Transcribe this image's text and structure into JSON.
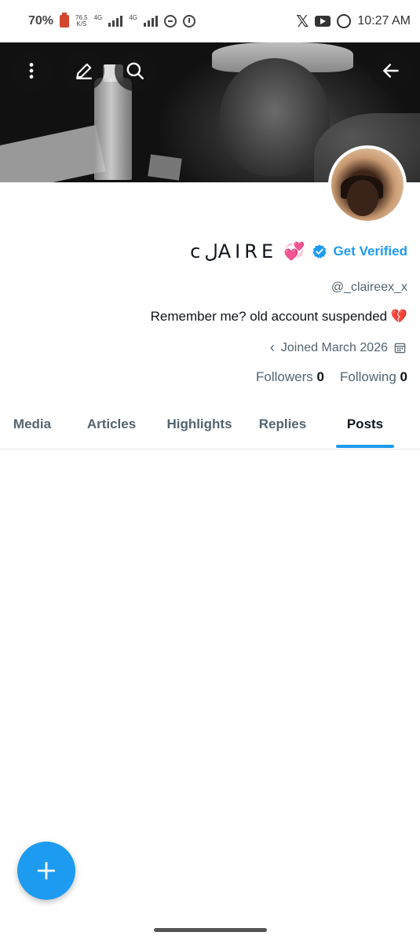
{
  "status_bar": {
    "battery": "70%",
    "net_speed_value": "76.5",
    "net_speed_unit": "K/S",
    "network_1": "4G",
    "network_2": "4G",
    "time": "10:27 AM",
    "icons": [
      "battery-icon",
      "signal-icon",
      "dnd-icon",
      "alarm-icon",
      "x-app-icon",
      "youtube-icon",
      "whatsapp-icon"
    ]
  },
  "header": {
    "buttons": [
      "more-options",
      "edit",
      "search",
      "back"
    ]
  },
  "profile": {
    "display_name": "cلAIRE",
    "name_emoji": "💞",
    "get_verified_label": "Get Verified",
    "handle": "@_claireex_x",
    "bio": "Remember me? old account suspended 💔",
    "joined": "Joined March 2026",
    "followers_label": "Followers",
    "followers_count": "0",
    "following_label": "Following",
    "following_count": "0"
  },
  "tabs": [
    {
      "label": "Media",
      "active": false
    },
    {
      "label": "Articles",
      "active": false
    },
    {
      "label": "Highlights",
      "active": false
    },
    {
      "label": "Replies",
      "active": false
    },
    {
      "label": "Posts",
      "active": true
    }
  ],
  "colors": {
    "accent": "#1d9bf0",
    "text_primary": "#0f1419",
    "text_secondary": "#536471"
  }
}
